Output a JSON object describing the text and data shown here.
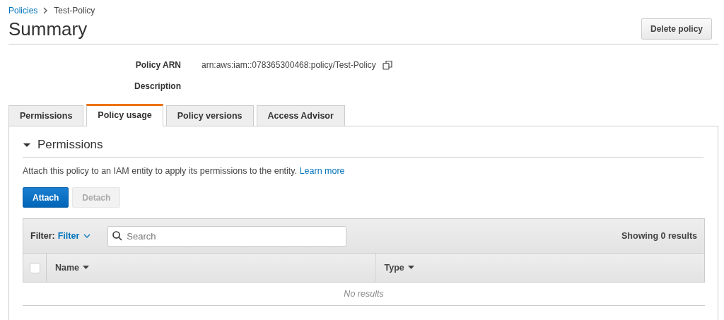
{
  "breadcrumb": [
    "Policies",
    "Test-Policy"
  ],
  "title": "Summary",
  "header_button": "Delete policy",
  "details": [
    {
      "label": "Policy ARN",
      "value": "arn:aws:iam::078365300468:policy/Test-Policy",
      "copyable": true
    },
    {
      "label": "Description",
      "copyable": false
    }
  ],
  "tabs": [
    {
      "label": "Permissions",
      "selected": false
    },
    {
      "label": "Policy usage",
      "selected": true
    },
    {
      "label": "Policy versions",
      "selected": false
    },
    {
      "label": "Access Advisor",
      "selected": false
    }
  ],
  "section": {
    "title": "Permissions",
    "expanded": true,
    "text": "Attach this policy to an IAM entity to apply its permissions to the entity.",
    "link": "Learn more"
  },
  "buttons": [
    {
      "label": "Attach",
      "kind": "primary",
      "disabled": false
    },
    {
      "label": "Detach",
      "kind": "secondary",
      "disabled": true
    }
  ],
  "table": {
    "filter_label": "Filter:",
    "filter_value": "Filter",
    "search_placeholder": "Search",
    "count": "Showing 0 results",
    "select_all_checked": false,
    "columns": [
      {
        "label": "Name"
      },
      {
        "label": "Type"
      }
    ],
    "empty_text": "No results"
  }
}
